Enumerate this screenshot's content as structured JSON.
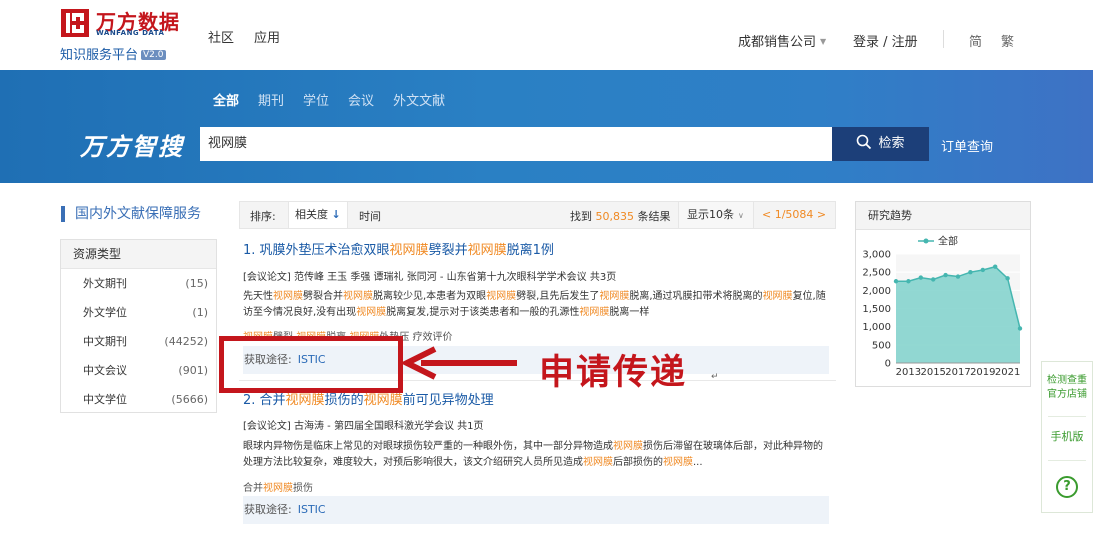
{
  "header": {
    "logo_cn": "万方数据",
    "logo_en": "WANFANG DATA",
    "logo_sub": "知识服务平台",
    "logo_version": "V2.0",
    "nav": [
      "社区",
      "应用"
    ],
    "company": "成都销售公司",
    "login": "登录 / 注册",
    "lang_simplified": "简",
    "lang_traditional": "繁"
  },
  "search": {
    "scope_tabs": [
      "全部",
      "期刊",
      "学位",
      "会议",
      "外文文献"
    ],
    "active_scope": "全部",
    "brand": "万方智搜",
    "query": "视网膜",
    "button_label": "检索",
    "order_link": "订单查询",
    "brand_color": "#2a80c4"
  },
  "sidebar": {
    "title": "国内外文献保障服务",
    "header": "资源类型",
    "items": [
      {
        "label": "外文期刊",
        "count": "(15)"
      },
      {
        "label": "外文学位",
        "count": "(1)"
      },
      {
        "label": "中文期刊",
        "count": "(44252)"
      },
      {
        "label": "中文会议",
        "count": "(901)"
      },
      {
        "label": "中文学位",
        "count": "(5666)"
      }
    ]
  },
  "toolbar": {
    "sort_label": "排序:",
    "relevance": "相关度",
    "time": "时间",
    "found_prefix": "找到",
    "found_count": "50,835",
    "found_suffix": "条结果",
    "page_size": "显示10条",
    "page_info": "< 1/5084 >"
  },
  "results": [
    {
      "title_parts": [
        "1. 巩膜外垫压术治愈双眼",
        "视网膜",
        "劈裂并",
        "视网膜",
        "脱离1例"
      ],
      "meta": "[会议论文]  范传峰 王玉 季强 谭瑞礼 张同河  - 山东省第十九次眼科学学术会议   共3页",
      "abstract": "先天性视网膜劈裂合并视网膜脱离较少见,本患者为双眼视网膜劈裂,且先后发生了视网膜脱离,通过巩膜扣带术将脱离的视网膜复位,随访至今情况良好,没有出现视网膜脱离复发,提示对于该类患者和一般的孔源性视网膜脱离一样",
      "keywords": "视网膜劈裂 视网膜脱离 视网膜外垫压 疗效评价",
      "access_label": "获取途径:",
      "access_source": "ISTIC"
    },
    {
      "title_parts": [
        "2. 合并",
        "视网膜",
        "损伤的",
        "视网膜",
        "前可见异物处理"
      ],
      "meta": "[会议论文]  古海涛  - 第四届全国眼科激光学会议   共1页",
      "abstract": "眼球内异物伤是临床上常见的对眼球损伤较严重的一种眼外伤，其中一部分异物造成视网膜损伤后滞留在玻璃体后部，对此种异物的处理方法比较复杂，难度较大，对预后影响很大，该文介绍研究人员所见造成视网膜后部损伤的视网膜...",
      "keywords": "合并视网膜损伤",
      "access_label": "获取途径:",
      "access_source": "ISTIC"
    }
  ],
  "annotation": {
    "text": "申请传递",
    "color": "#c4161c"
  },
  "trend_panel": {
    "title": "研究趋势"
  },
  "chart_data": {
    "type": "area",
    "title": "研究趋势",
    "legend": "全部",
    "legend_position": "top",
    "x": [
      2012,
      2013,
      2014,
      2015,
      2016,
      2017,
      2018,
      2019,
      2020,
      2021,
      2022
    ],
    "x_ticks": [
      "2013",
      "2015",
      "2017",
      "2019",
      "2021"
    ],
    "series": [
      {
        "name": "全部",
        "values": [
          2250,
          2250,
          2350,
          2300,
          2420,
          2380,
          2500,
          2560,
          2650,
          2330,
          950
        ]
      }
    ],
    "ylim": [
      0,
      3000
    ],
    "y_ticks": [
      "0",
      "500",
      "1,000",
      "1,500",
      "2,000",
      "2,500",
      "3,000"
    ],
    "color": "#45b6b0"
  },
  "float_bar": {
    "item1": "检测查重 官方店铺",
    "item2": "手机版",
    "help": "?"
  }
}
